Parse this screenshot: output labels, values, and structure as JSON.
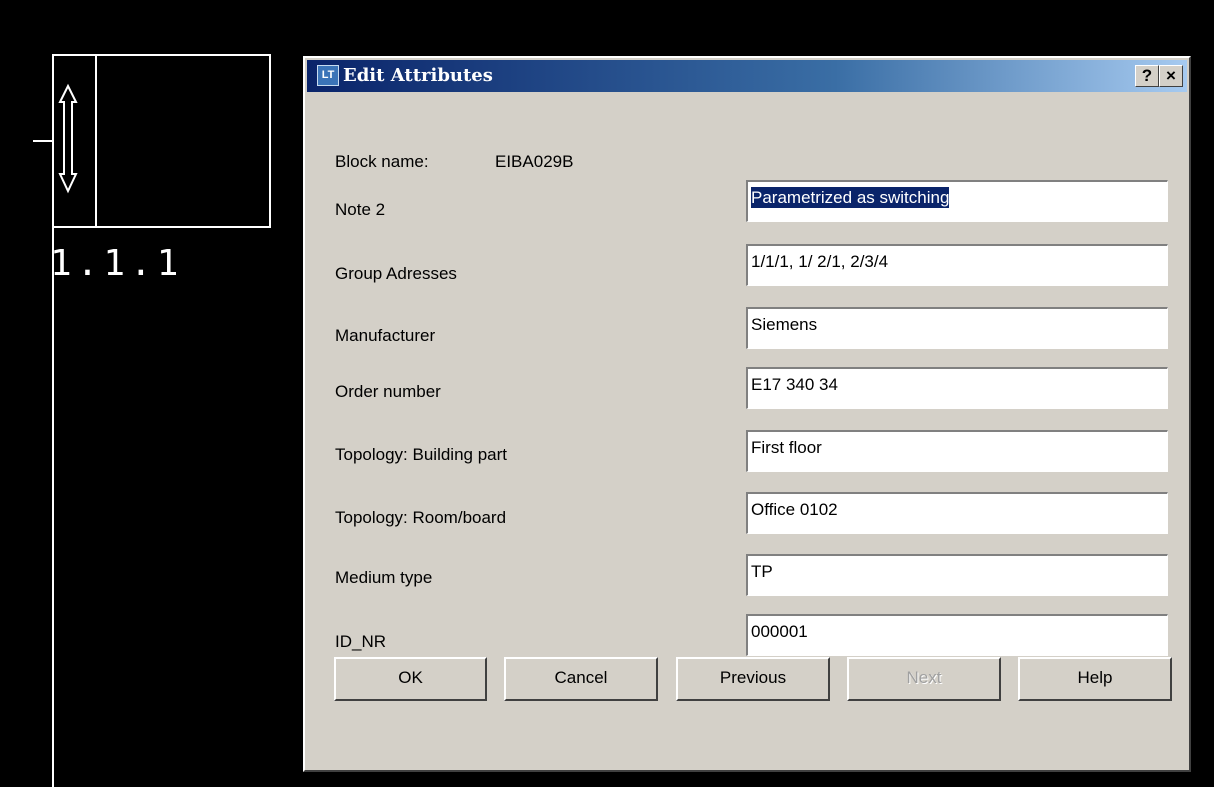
{
  "canvas": {
    "device_label": "1.1.1"
  },
  "dialog": {
    "title": "Edit Attributes",
    "title_icon": "LT",
    "titlebar_buttons": {
      "help": "?",
      "close": "×"
    },
    "block_name_label": "Block name:",
    "block_name_value": "EIBA029B",
    "attributes": [
      {
        "label": "Note 2",
        "value": "Parametrized as switching",
        "selected": true
      },
      {
        "label": "Group Adresses",
        "value": "1/1/1, 1/ 2/1, 2/3/4"
      },
      {
        "label": "Manufacturer",
        "value": "Siemens"
      },
      {
        "label": "Order number",
        "value": "E17 340 34"
      },
      {
        "label": "Topology: Building part",
        "value": "First floor"
      },
      {
        "label": "Topology: Room/board",
        "value": "Office 0102"
      },
      {
        "label": "Medium type",
        "value": "TP"
      },
      {
        "label": "ID_NR",
        "value": "000001"
      }
    ],
    "buttons": {
      "ok": "OK",
      "cancel": "Cancel",
      "previous": "Previous",
      "next": "Next",
      "help": "Help"
    }
  },
  "colors": {
    "canvas_bg": "#000000",
    "dialog_bg": "#d4d0c8",
    "titlebar_start": "#0a246a",
    "titlebar_end": "#a6caf0",
    "selection": "#0a246a"
  }
}
